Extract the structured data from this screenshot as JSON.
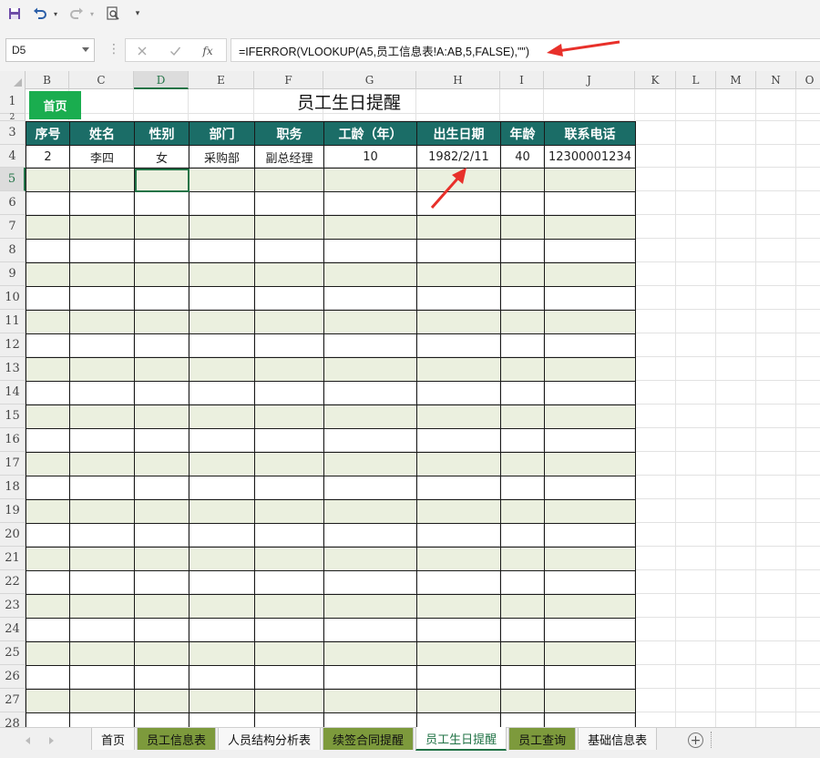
{
  "toolbar": {
    "icons": [
      "save-icon",
      "undo-icon",
      "dropdown-icon",
      "redo-icon",
      "dropdown-icon",
      "print-preview-icon",
      "customize-icon"
    ]
  },
  "formula_bar": {
    "name_box": "D5",
    "fx_label": "fx",
    "formula": "=IFERROR(VLOOKUP(A5,员工信息表!A:AB,5,FALSE),\"\")"
  },
  "columns": [
    "B",
    "C",
    "D",
    "E",
    "F",
    "G",
    "H",
    "I",
    "J",
    "K",
    "L",
    "M",
    "N",
    "O"
  ],
  "rows": [
    "1",
    "2",
    "3",
    "4",
    "5",
    "6",
    "7",
    "8",
    "9",
    "10",
    "11",
    "12",
    "13",
    "14",
    "15",
    "16",
    "17",
    "18",
    "19",
    "20",
    "21",
    "22",
    "23",
    "24",
    "25",
    "26",
    "27",
    "28"
  ],
  "sheet": {
    "home_button": "首页",
    "title": "员工生日提醒",
    "headers": [
      "序号",
      "姓名",
      "性别",
      "部门",
      "职务",
      "工龄（年）",
      "出生日期",
      "年龄",
      "联系电话"
    ],
    "records": [
      [
        "2",
        "李四",
        "女",
        "采购部",
        "副总经理",
        "10",
        "1982/2/11",
        "40",
        "12300001234"
      ]
    ]
  },
  "tabs": [
    {
      "label": "首页",
      "style": "plain"
    },
    {
      "label": "员工信息表",
      "style": "green"
    },
    {
      "label": "人员结构分析表",
      "style": "plain"
    },
    {
      "label": "续签合同提醒",
      "style": "green"
    },
    {
      "label": "员工生日提醒",
      "style": "active"
    },
    {
      "label": "员工查询",
      "style": "green"
    },
    {
      "label": "基础信息表",
      "style": "plain"
    }
  ],
  "colors": {
    "header_fill": "#1b6d67",
    "band_fill": "#ebf0df",
    "home_button": "#1aad4f",
    "accent": "#217346",
    "annotation_arrow": "#e8302a",
    "tab_green": "#7d9a3c"
  }
}
